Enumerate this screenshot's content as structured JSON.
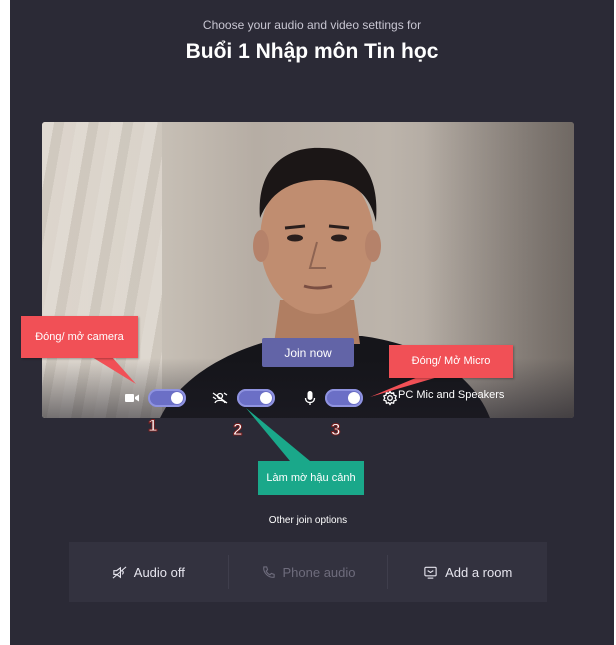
{
  "header": {
    "subtitle": "Choose your audio and video settings for",
    "title": "Buổi 1 Nhập môn Tin học"
  },
  "preview": {
    "join_label": "Join now",
    "device_label": "PC Mic and Speakers",
    "camera_on": true,
    "background_blur_on": true,
    "mic_on": true
  },
  "annotations": {
    "camera_callout": "Đóng/ mở camera",
    "micro_callout": "Đóng/ Mở Micro",
    "blur_callout": "Làm mờ hậu cảnh",
    "num1": "1",
    "num2": "2",
    "num3": "3"
  },
  "other_options": {
    "heading": "Other join options",
    "audio_off": "Audio off",
    "phone_audio": "Phone audio",
    "add_room": "Add a room"
  },
  "colors": {
    "background": "#2b2a36",
    "accent": "#6264a7",
    "callout_red": "#f15056",
    "callout_green": "#1aa88a"
  },
  "icons": [
    "camera-icon",
    "blur-icon",
    "mic-icon",
    "settings-icon",
    "audio-off-icon",
    "phone-icon",
    "room-icon"
  ]
}
